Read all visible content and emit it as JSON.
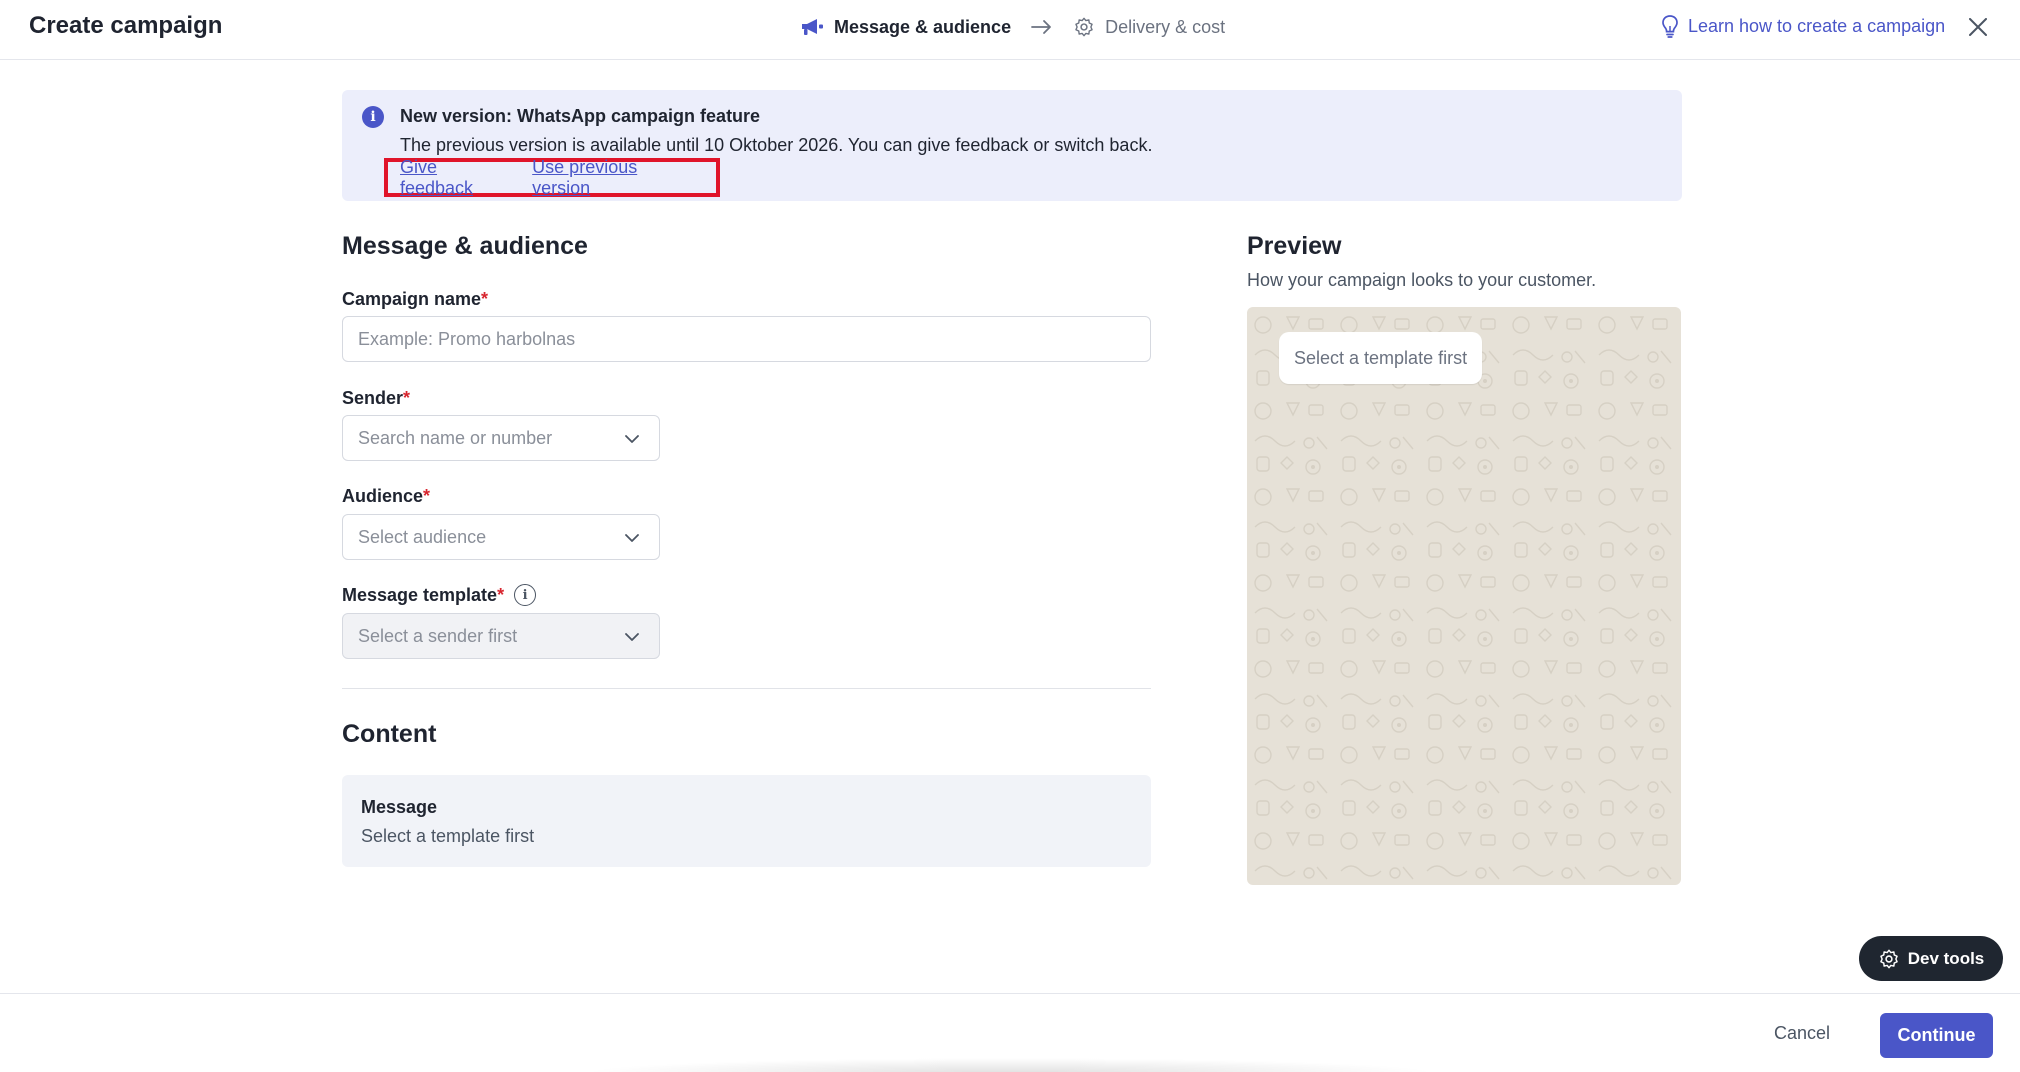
{
  "header": {
    "title": "Create campaign",
    "steps": [
      {
        "label": "Message & audience",
        "icon": "megaphone-icon",
        "state": "active"
      },
      {
        "label": "Delivery & cost",
        "icon": "gear-icon",
        "state": "inactive"
      }
    ],
    "learn_link": "Learn how to create a campaign"
  },
  "banner": {
    "title": "New version: WhatsApp campaign feature",
    "text": "The previous version is available until 10 Oktober 2026. You can give feedback or switch back.",
    "give_feedback": "Give feedback",
    "use_previous": "Use previous version"
  },
  "form": {
    "section_title": "Message & audience",
    "campaign_name": {
      "label": "Campaign name",
      "required_mark": "*",
      "placeholder": "Example: Promo harbolnas"
    },
    "sender": {
      "label": "Sender",
      "required_mark": "*",
      "placeholder": "Search name or number"
    },
    "audience": {
      "label": "Audience",
      "required_mark": "*",
      "placeholder": "Select audience"
    },
    "template": {
      "label": "Message template",
      "required_mark": "*",
      "placeholder": "Select a sender first"
    }
  },
  "content": {
    "section_title": "Content",
    "message_title": "Message",
    "message_sub": "Select a template first"
  },
  "preview": {
    "title": "Preview",
    "subtitle": "How your campaign looks to your customer.",
    "bubble": "Select a template first"
  },
  "footer": {
    "cancel": "Cancel",
    "continue": "Continue"
  },
  "devtools": {
    "label": "Dev tools"
  },
  "colors": {
    "accent": "#4a56c8",
    "banner_bg": "#eceefb",
    "highlight_border": "#e0142a",
    "required": "#d7262f"
  }
}
